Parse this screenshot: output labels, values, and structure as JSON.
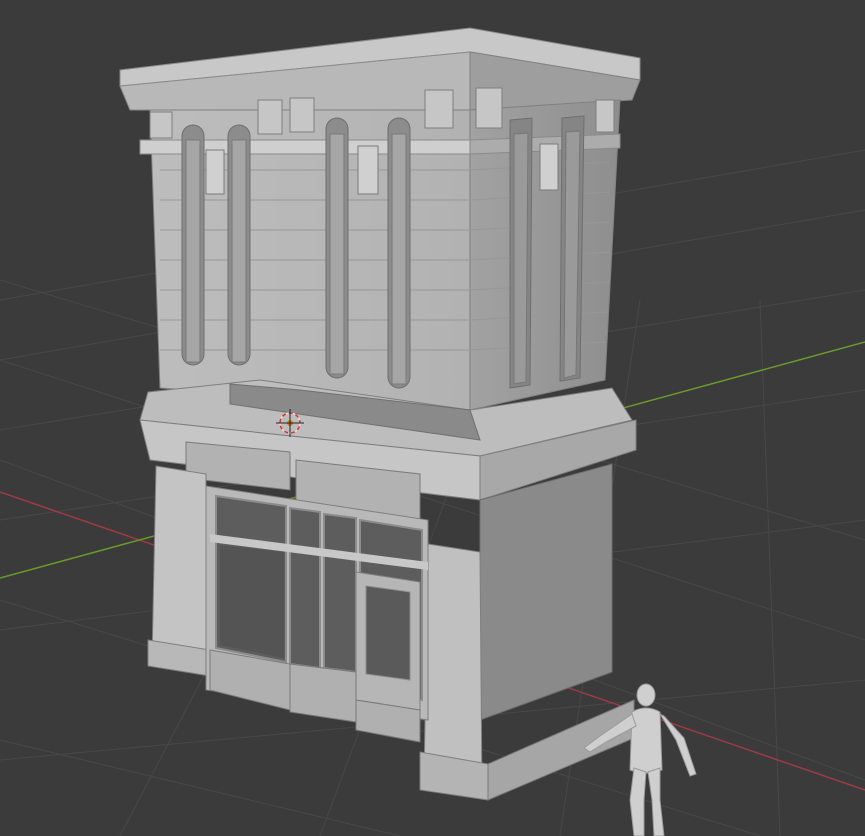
{
  "viewport": {
    "mode": "3d-viewport",
    "grid": true,
    "axes": [
      "x",
      "y"
    ]
  },
  "colors": {
    "background": "#3b3b3b",
    "grid": "#4a4a4a",
    "x_axis": "#a03a44",
    "y_axis": "#6a9a2a",
    "model_light": "#c4c4c4",
    "model_mid": "#9c9c9c",
    "model_dark": "#6e6e6e",
    "window_dark": "#5a5a5a",
    "origin": "#d87a1a"
  },
  "objects": [
    {
      "name": "building-upper-floor",
      "type": "mesh"
    },
    {
      "name": "shopfront-ground-floor",
      "type": "mesh"
    },
    {
      "name": "human-scale-reference",
      "type": "mesh"
    },
    {
      "name": "3d-cursor",
      "type": "cursor"
    }
  ]
}
